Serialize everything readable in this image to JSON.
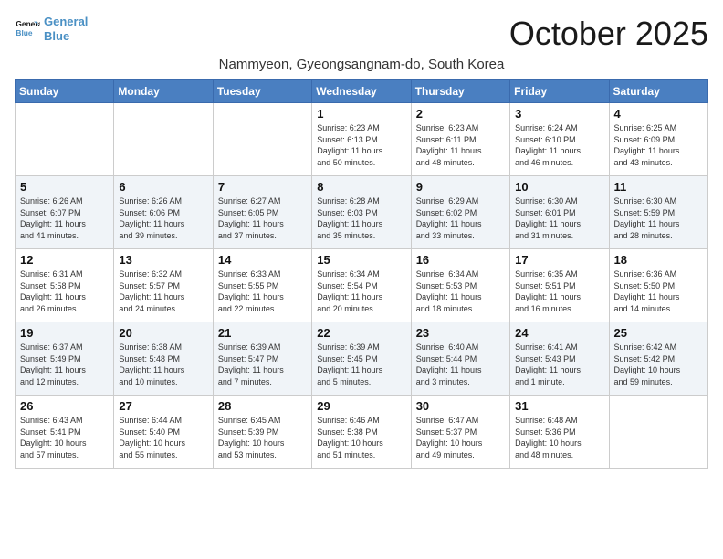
{
  "header": {
    "logo_line1": "General",
    "logo_line2": "Blue",
    "month_title": "October 2025",
    "subtitle": "Nammyeon, Gyeongsangnam-do, South Korea"
  },
  "days_of_week": [
    "Sunday",
    "Monday",
    "Tuesday",
    "Wednesday",
    "Thursday",
    "Friday",
    "Saturday"
  ],
  "weeks": [
    [
      {
        "day": "",
        "info": ""
      },
      {
        "day": "",
        "info": ""
      },
      {
        "day": "",
        "info": ""
      },
      {
        "day": "1",
        "info": "Sunrise: 6:23 AM\nSunset: 6:13 PM\nDaylight: 11 hours\nand 50 minutes."
      },
      {
        "day": "2",
        "info": "Sunrise: 6:23 AM\nSunset: 6:11 PM\nDaylight: 11 hours\nand 48 minutes."
      },
      {
        "day": "3",
        "info": "Sunrise: 6:24 AM\nSunset: 6:10 PM\nDaylight: 11 hours\nand 46 minutes."
      },
      {
        "day": "4",
        "info": "Sunrise: 6:25 AM\nSunset: 6:09 PM\nDaylight: 11 hours\nand 43 minutes."
      }
    ],
    [
      {
        "day": "5",
        "info": "Sunrise: 6:26 AM\nSunset: 6:07 PM\nDaylight: 11 hours\nand 41 minutes."
      },
      {
        "day": "6",
        "info": "Sunrise: 6:26 AM\nSunset: 6:06 PM\nDaylight: 11 hours\nand 39 minutes."
      },
      {
        "day": "7",
        "info": "Sunrise: 6:27 AM\nSunset: 6:05 PM\nDaylight: 11 hours\nand 37 minutes."
      },
      {
        "day": "8",
        "info": "Sunrise: 6:28 AM\nSunset: 6:03 PM\nDaylight: 11 hours\nand 35 minutes."
      },
      {
        "day": "9",
        "info": "Sunrise: 6:29 AM\nSunset: 6:02 PM\nDaylight: 11 hours\nand 33 minutes."
      },
      {
        "day": "10",
        "info": "Sunrise: 6:30 AM\nSunset: 6:01 PM\nDaylight: 11 hours\nand 31 minutes."
      },
      {
        "day": "11",
        "info": "Sunrise: 6:30 AM\nSunset: 5:59 PM\nDaylight: 11 hours\nand 28 minutes."
      }
    ],
    [
      {
        "day": "12",
        "info": "Sunrise: 6:31 AM\nSunset: 5:58 PM\nDaylight: 11 hours\nand 26 minutes."
      },
      {
        "day": "13",
        "info": "Sunrise: 6:32 AM\nSunset: 5:57 PM\nDaylight: 11 hours\nand 24 minutes."
      },
      {
        "day": "14",
        "info": "Sunrise: 6:33 AM\nSunset: 5:55 PM\nDaylight: 11 hours\nand 22 minutes."
      },
      {
        "day": "15",
        "info": "Sunrise: 6:34 AM\nSunset: 5:54 PM\nDaylight: 11 hours\nand 20 minutes."
      },
      {
        "day": "16",
        "info": "Sunrise: 6:34 AM\nSunset: 5:53 PM\nDaylight: 11 hours\nand 18 minutes."
      },
      {
        "day": "17",
        "info": "Sunrise: 6:35 AM\nSunset: 5:51 PM\nDaylight: 11 hours\nand 16 minutes."
      },
      {
        "day": "18",
        "info": "Sunrise: 6:36 AM\nSunset: 5:50 PM\nDaylight: 11 hours\nand 14 minutes."
      }
    ],
    [
      {
        "day": "19",
        "info": "Sunrise: 6:37 AM\nSunset: 5:49 PM\nDaylight: 11 hours\nand 12 minutes."
      },
      {
        "day": "20",
        "info": "Sunrise: 6:38 AM\nSunset: 5:48 PM\nDaylight: 11 hours\nand 10 minutes."
      },
      {
        "day": "21",
        "info": "Sunrise: 6:39 AM\nSunset: 5:47 PM\nDaylight: 11 hours\nand 7 minutes."
      },
      {
        "day": "22",
        "info": "Sunrise: 6:39 AM\nSunset: 5:45 PM\nDaylight: 11 hours\nand 5 minutes."
      },
      {
        "day": "23",
        "info": "Sunrise: 6:40 AM\nSunset: 5:44 PM\nDaylight: 11 hours\nand 3 minutes."
      },
      {
        "day": "24",
        "info": "Sunrise: 6:41 AM\nSunset: 5:43 PM\nDaylight: 11 hours\nand 1 minute."
      },
      {
        "day": "25",
        "info": "Sunrise: 6:42 AM\nSunset: 5:42 PM\nDaylight: 10 hours\nand 59 minutes."
      }
    ],
    [
      {
        "day": "26",
        "info": "Sunrise: 6:43 AM\nSunset: 5:41 PM\nDaylight: 10 hours\nand 57 minutes."
      },
      {
        "day": "27",
        "info": "Sunrise: 6:44 AM\nSunset: 5:40 PM\nDaylight: 10 hours\nand 55 minutes."
      },
      {
        "day": "28",
        "info": "Sunrise: 6:45 AM\nSunset: 5:39 PM\nDaylight: 10 hours\nand 53 minutes."
      },
      {
        "day": "29",
        "info": "Sunrise: 6:46 AM\nSunset: 5:38 PM\nDaylight: 10 hours\nand 51 minutes."
      },
      {
        "day": "30",
        "info": "Sunrise: 6:47 AM\nSunset: 5:37 PM\nDaylight: 10 hours\nand 49 minutes."
      },
      {
        "day": "31",
        "info": "Sunrise: 6:48 AM\nSunset: 5:36 PM\nDaylight: 10 hours\nand 48 minutes."
      },
      {
        "day": "",
        "info": ""
      }
    ]
  ]
}
